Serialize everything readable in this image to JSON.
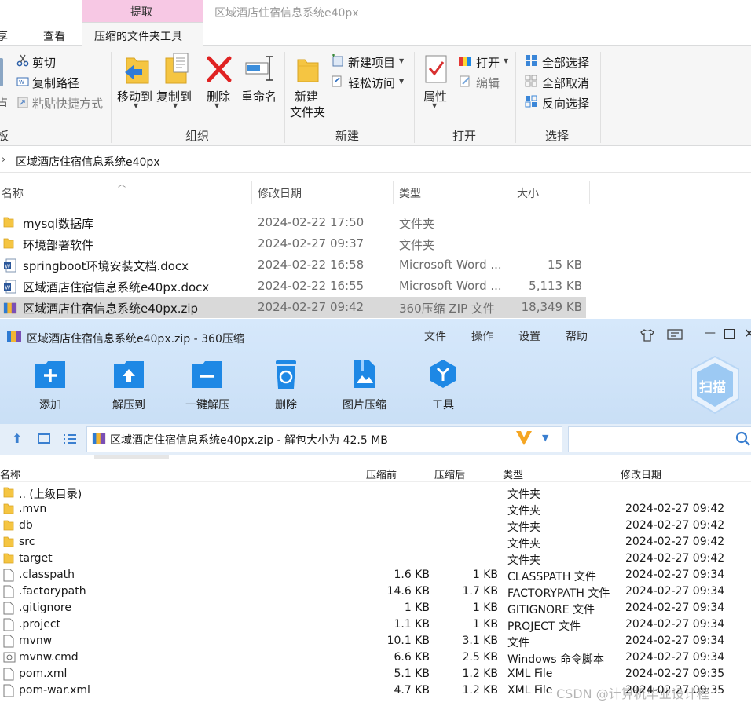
{
  "explorer": {
    "context_tab_group": "提取",
    "window_title": "区域酒店住宿信息系统e40px",
    "tabs": [
      "享",
      "查看",
      "压缩的文件夹工具"
    ],
    "clipboard": {
      "cut": "剪切",
      "copy_path": "复制路径",
      "paste_shortcut": "粘贴快捷方式",
      "group": "板"
    },
    "organize": {
      "move_to": "移动到",
      "copy_to": "复制到",
      "delete": "删除",
      "rename": "重命名",
      "group": "组织"
    },
    "new": {
      "new_folder_line1": "新建",
      "new_folder_line2": "文件夹",
      "new_item": "新建项目",
      "easy_access": "轻松访问",
      "group": "新建"
    },
    "open": {
      "properties": "属性",
      "open": "打开",
      "edit": "编辑",
      "group": "打开"
    },
    "select": {
      "select_all": "全部选择",
      "select_none": "全部取消",
      "invert": "反向选择",
      "group": "选择"
    },
    "address": "区域酒店住宿信息系统e40px",
    "columns": {
      "name": "名称",
      "modified": "修改日期",
      "type": "类型",
      "size": "大小"
    },
    "files": [
      {
        "name": "mysql数据库",
        "modified": "2024-02-22 17:50",
        "type": "文件夹",
        "size": "",
        "icon": "folder-icon"
      },
      {
        "name": "环境部署软件",
        "modified": "2024-02-27 09:37",
        "type": "文件夹",
        "size": "",
        "icon": "folder-icon"
      },
      {
        "name": "springboot环境安装文档.docx",
        "modified": "2024-02-22 16:58",
        "type": "Microsoft Word ...",
        "size": "15 KB",
        "icon": "docx-icon"
      },
      {
        "name": "区域酒店住宿信息系统e40px.docx",
        "modified": "2024-02-22 16:55",
        "type": "Microsoft Word ...",
        "size": "5,113 KB",
        "icon": "docx-icon"
      },
      {
        "name": "区域酒店住宿信息系统e40px.zip",
        "modified": "2024-02-27 09:42",
        "type": "360压缩 ZIP 文件",
        "size": "18,349 KB",
        "icon": "zip-icon",
        "selected": true
      }
    ]
  },
  "zip360": {
    "title": "区域酒店住宿信息系统e40px.zip - 360压缩",
    "menu": [
      "文件",
      "操作",
      "设置",
      "帮助"
    ],
    "toolbar": [
      "添加",
      "解压到",
      "一键解压",
      "删除",
      "图片压缩",
      "工具"
    ],
    "scan_badge": "扫描",
    "path": "区域酒店住宿信息系统e40px.zip - 解包大小为 42.5 MB",
    "columns": {
      "name": "名称",
      "before": "压缩前",
      "after": "压缩后",
      "type": "类型",
      "modified": "修改日期"
    },
    "rows": [
      {
        "name": ".. (上级目录)",
        "before": "",
        "after": "",
        "type": "文件夹",
        "modified": "",
        "icon": "folder-icon"
      },
      {
        "name": ".mvn",
        "before": "",
        "after": "",
        "type": "文件夹",
        "modified": "2024-02-27 09:42",
        "icon": "folder-icon"
      },
      {
        "name": "db",
        "before": "",
        "after": "",
        "type": "文件夹",
        "modified": "2024-02-27 09:42",
        "icon": "folder-icon"
      },
      {
        "name": "src",
        "before": "",
        "after": "",
        "type": "文件夹",
        "modified": "2024-02-27 09:42",
        "icon": "folder-icon"
      },
      {
        "name": "target",
        "before": "",
        "after": "",
        "type": "文件夹",
        "modified": "2024-02-27 09:42",
        "icon": "folder-icon"
      },
      {
        "name": ".classpath",
        "before": "1.6 KB",
        "after": "1 KB",
        "type": "CLASSPATH 文件",
        "modified": "2024-02-27 09:34",
        "icon": "file-icon"
      },
      {
        "name": ".factorypath",
        "before": "14.6 KB",
        "after": "1.7 KB",
        "type": "FACTORYPATH 文件",
        "modified": "2024-02-27 09:34",
        "icon": "file-icon"
      },
      {
        "name": ".gitignore",
        "before": "1 KB",
        "after": "1 KB",
        "type": "GITIGNORE 文件",
        "modified": "2024-02-27 09:34",
        "icon": "file-icon"
      },
      {
        "name": ".project",
        "before": "1.1 KB",
        "after": "1 KB",
        "type": "PROJECT 文件",
        "modified": "2024-02-27 09:34",
        "icon": "file-icon"
      },
      {
        "name": "mvnw",
        "before": "10.1 KB",
        "after": "3.1 KB",
        "type": "文件",
        "modified": "2024-02-27 09:34",
        "icon": "file-icon"
      },
      {
        "name": "mvnw.cmd",
        "before": "6.6 KB",
        "after": "2.5 KB",
        "type": "Windows 命令脚本",
        "modified": "2024-02-27 09:34",
        "icon": "cmd-icon"
      },
      {
        "name": "pom.xml",
        "before": "5.1 KB",
        "after": "1.2 KB",
        "type": "XML File",
        "modified": "2024-02-27 09:35",
        "icon": "file-icon"
      },
      {
        "name": "pom-war.xml",
        "before": "4.7 KB",
        "after": "1.2 KB",
        "type": "XML File",
        "modified": "2024-02-27 09:35",
        "icon": "file-icon"
      }
    ]
  },
  "watermark": "CSDN @计算机毕业设计程"
}
